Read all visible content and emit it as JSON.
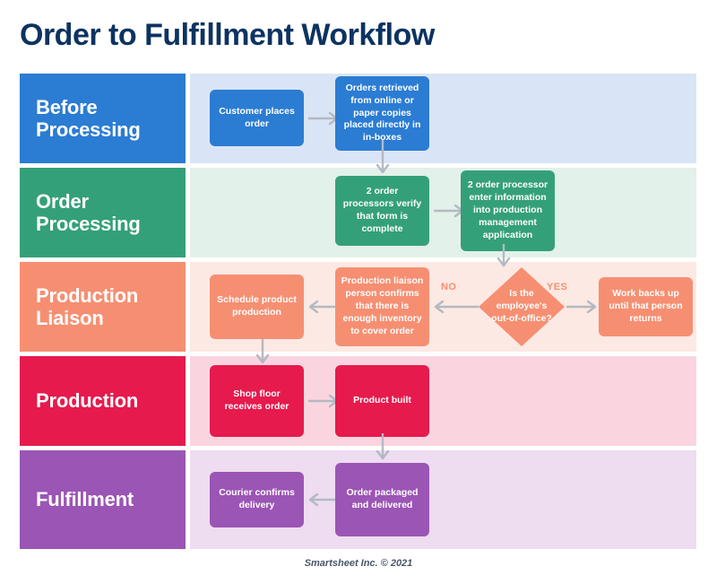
{
  "page": {
    "title": "Order to Fulfillment Workflow",
    "title_color": "#0d3361",
    "background": "#ffffff",
    "footer": "Smartsheet Inc. © 2021",
    "arrow_color": "#b3b9c2"
  },
  "lanes": [
    {
      "id": "before-processing",
      "label": "Before Processing",
      "header_color": "#2b7cd3",
      "body_color": "#d9e5f6",
      "node_color": "#2b7cd3",
      "nodes": [
        {
          "id": "customer-places-order",
          "text": "Customer places order"
        },
        {
          "id": "orders-retrieved",
          "text": "Orders retrieved from online or paper copies placed directly in in-boxes"
        }
      ]
    },
    {
      "id": "order-processing",
      "label": "Order Processing",
      "header_color": "#34a079",
      "body_color": "#e2f1e9",
      "node_color": "#34a079",
      "nodes": [
        {
          "id": "verify-form",
          "text": "2 order processors verify that form is complete"
        },
        {
          "id": "enter-information",
          "text": "2 order processor enter information into production management application"
        }
      ]
    },
    {
      "id": "production-liaison",
      "label": "Production Liaison",
      "header_color": "#f68f72",
      "body_color": "#fde9e3",
      "node_color": "#f68f72",
      "nodes": [
        {
          "id": "schedule-product-production",
          "text": "Schedule product production"
        },
        {
          "id": "confirm-inventory",
          "text": "Production liaison person confirms that there is enough inventory to cover order"
        },
        {
          "id": "work-backs-up",
          "text": "Work backs up until that person returns"
        }
      ],
      "decision": {
        "id": "out-of-office-decision",
        "text": "Is the employee's out-of-office?",
        "no_label": "NO",
        "yes_label": "YES",
        "label_color": "#f68f72"
      }
    },
    {
      "id": "production",
      "label": "Production",
      "header_color": "#e61a4d",
      "body_color": "#fad5df",
      "node_color": "#e61a4d",
      "nodes": [
        {
          "id": "shop-floor-receives-order",
          "text": "Shop floor receives order"
        },
        {
          "id": "product-built",
          "text": "Product built"
        }
      ]
    },
    {
      "id": "fulfillment",
      "label": "Fulfillment",
      "header_color": "#9b55b5",
      "body_color": "#eedcf0",
      "node_color": "#9b55b5",
      "nodes": [
        {
          "id": "courier-confirms-delivery",
          "text": "Courier confirms delivery"
        },
        {
          "id": "order-packaged-delivered",
          "text": "Order packaged and delivered"
        }
      ]
    }
  ]
}
